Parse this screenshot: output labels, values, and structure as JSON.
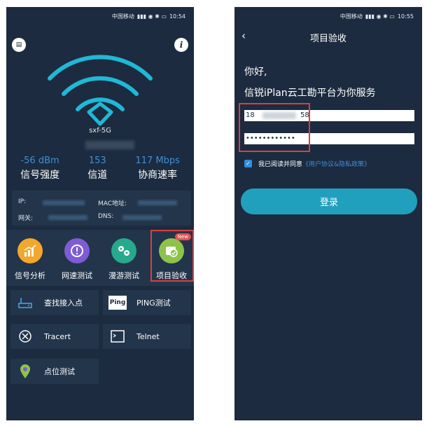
{
  "left": {
    "status": {
      "carrier": "中国移动",
      "time": "10:54"
    },
    "ssid": "sxf-5G",
    "stats": [
      {
        "value": "-56 dBm",
        "label": "信号强度"
      },
      {
        "value": "153",
        "label": "信道"
      },
      {
        "value": "117 Mbps",
        "label": "协商速率"
      }
    ],
    "info": {
      "ip": "IP:",
      "mac": "MAC地址:",
      "gateway": "网关:",
      "dns": "DNS:"
    },
    "tools": [
      {
        "label": "信号分析",
        "icon": "signal-analysis-icon",
        "color": "#f2a82d"
      },
      {
        "label": "网速测试",
        "icon": "speed-test-icon",
        "color": "#7d5cd6"
      },
      {
        "label": "漫游测试",
        "icon": "roaming-test-icon",
        "color": "#26a98c"
      },
      {
        "label": "项目验收",
        "icon": "project-acceptance-icon",
        "color": "#8ec34a"
      }
    ],
    "new_badge": "New",
    "list": [
      {
        "label": "查找接入点",
        "icon": "access-point-icon"
      },
      {
        "label": "PING测试",
        "icon": "ping-icon",
        "icon_text": "Ping"
      },
      {
        "label": "Tracert",
        "icon": "tracert-icon"
      },
      {
        "label": "Telnet",
        "icon": "telnet-icon"
      },
      {
        "label": "点位测试",
        "icon": "location-test-icon"
      }
    ]
  },
  "right": {
    "status": {
      "carrier": "中国移动",
      "time": "10:55"
    },
    "title": "项目验收",
    "greeting": "你好,",
    "subtitle": "信锐iPlan云工勘平台为你服务",
    "phone_prefix": "18",
    "phone_suffix": "58",
    "password": "••••••••••••",
    "agree_text": "我已阅读并同意",
    "agree_link": "《用户协议&隐私政策》",
    "login": "登录"
  },
  "colors": {
    "bg": "#1c2b3f",
    "panel": "#23354b",
    "accent": "#3e8fd8",
    "highlight": "#d9403e"
  }
}
